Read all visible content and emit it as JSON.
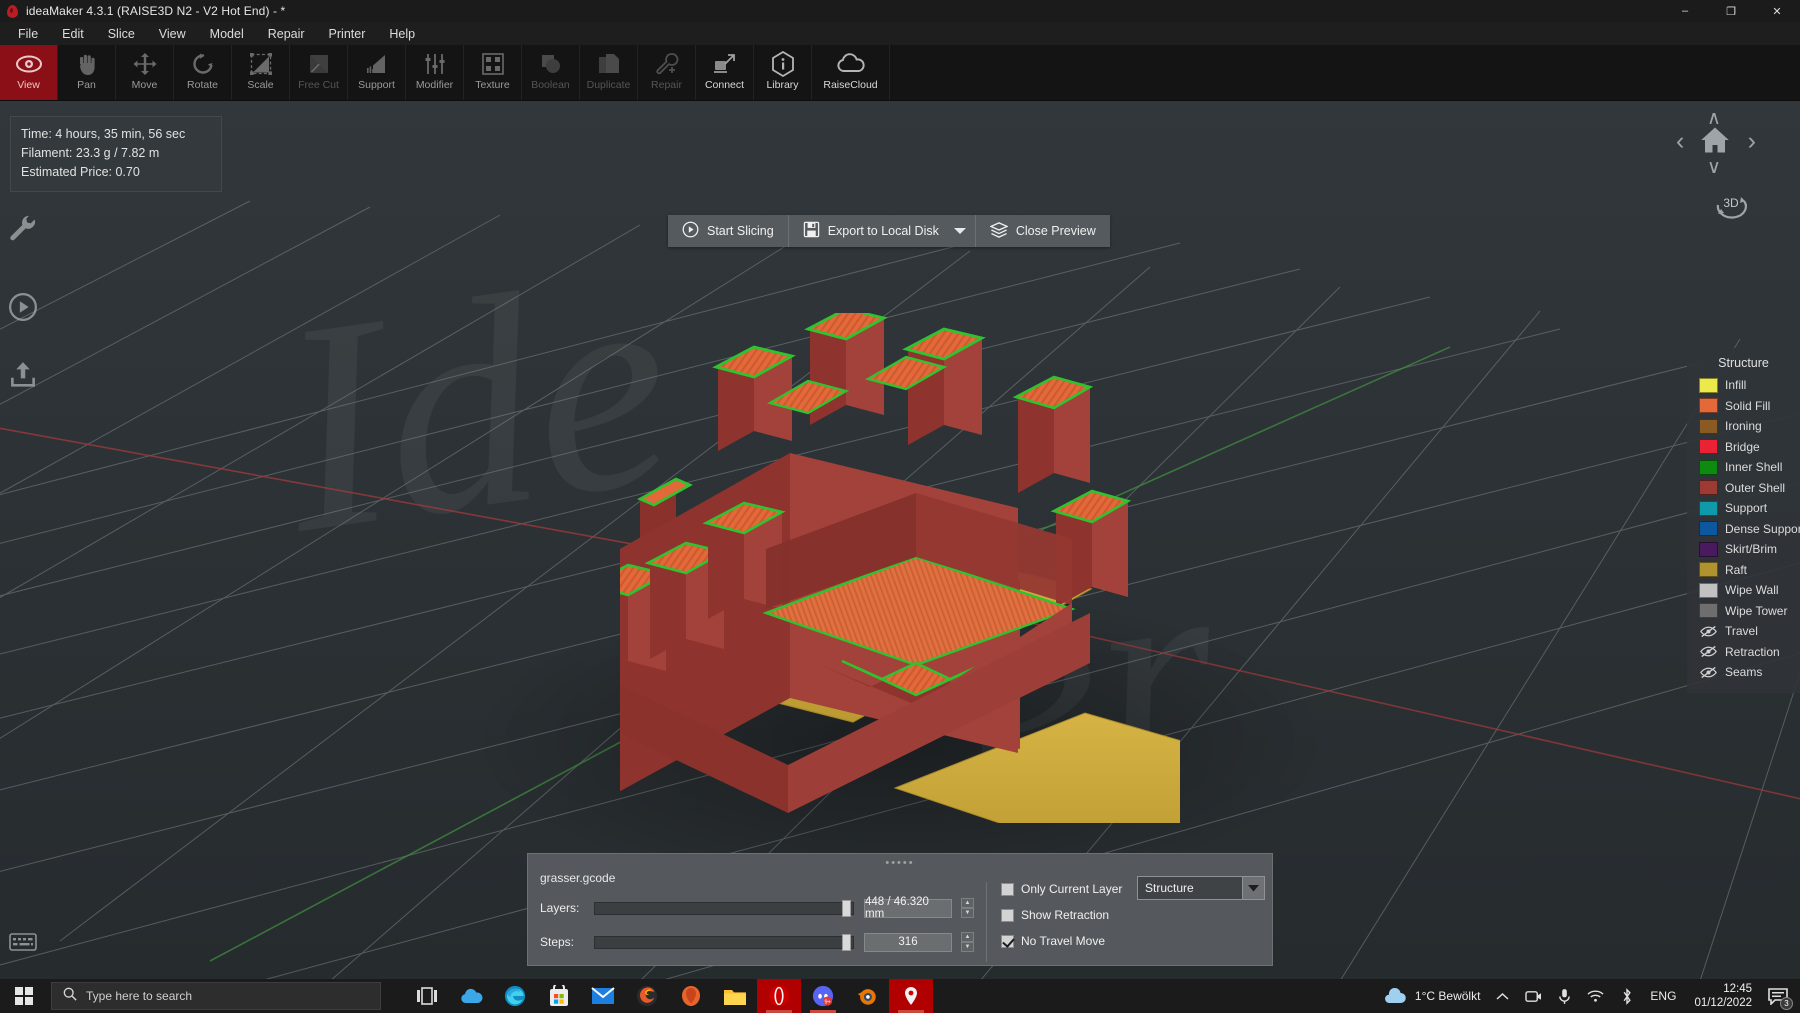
{
  "window": {
    "title": "ideaMaker 4.3.1 (RAISE3D N2 - V2 Hot End) - *",
    "minimize": "–",
    "maximize": "❐",
    "close": "✕"
  },
  "menu": {
    "items": [
      "File",
      "Edit",
      "Slice",
      "View",
      "Model",
      "Repair",
      "Printer",
      "Help"
    ]
  },
  "toolbar": {
    "items": [
      {
        "label": "View",
        "icon": "eye-icon",
        "state": "active"
      },
      {
        "label": "Pan",
        "icon": "hand-icon",
        "state": "normal"
      },
      {
        "label": "Move",
        "icon": "move-arrows-icon",
        "state": "normal"
      },
      {
        "label": "Rotate",
        "icon": "rotate-icon",
        "state": "normal"
      },
      {
        "label": "Scale",
        "icon": "scale-icon",
        "state": "normal"
      },
      {
        "label": "Free Cut",
        "icon": "free-cut-icon",
        "state": "disabled"
      },
      {
        "label": "Support",
        "icon": "support-icon",
        "state": "normal"
      },
      {
        "label": "Modifier",
        "icon": "sliders-icon",
        "state": "normal"
      },
      {
        "label": "Texture",
        "icon": "texture-grid-icon",
        "state": "normal"
      },
      {
        "label": "Boolean",
        "icon": "boolean-icon",
        "state": "disabled"
      },
      {
        "label": "Duplicate",
        "icon": "duplicate-icon",
        "state": "disabled"
      },
      {
        "label": "Repair",
        "icon": "wrench-plus-icon",
        "state": "disabled"
      },
      {
        "label": "Connect",
        "icon": "connect-icon",
        "state": "normal"
      },
      {
        "label": "Library",
        "icon": "info-hex-icon",
        "state": "normal"
      },
      {
        "label": "RaiseCloud",
        "icon": "cloud-icon",
        "state": "normal"
      }
    ]
  },
  "info": {
    "time": "Time: 4 hours, 35 min, 56 sec",
    "filament": "Filament: 23.3 g / 7.82 m",
    "price": "Estimated Price: 0.70"
  },
  "actions": {
    "start_slicing": "Start Slicing",
    "export_to_local_disk": "Export to Local Disk",
    "close_preview": "Close Preview"
  },
  "navigation": {
    "up": "∧",
    "down": "∨",
    "left": "‹",
    "right": "›",
    "home": "home-icon",
    "cube": "3D"
  },
  "legend": {
    "title": "Structure",
    "items": [
      {
        "label": "Infill",
        "color": "#ece94a",
        "type": "swatch"
      },
      {
        "label": "Solid Fill",
        "color": "#e3693a",
        "type": "swatch"
      },
      {
        "label": "Ironing",
        "color": "#8a5a22",
        "type": "swatch"
      },
      {
        "label": "Bridge",
        "color": "#ea2233",
        "type": "swatch"
      },
      {
        "label": "Inner Shell",
        "color": "#0e8a10",
        "type": "swatch"
      },
      {
        "label": "Outer Shell",
        "color": "#9c3a34",
        "type": "swatch"
      },
      {
        "label": "Support",
        "color": "#0f9aac",
        "type": "swatch"
      },
      {
        "label": "Dense Support",
        "color": "#0b57a0",
        "type": "swatch"
      },
      {
        "label": "Skirt/Brim",
        "color": "#4a1a5e",
        "type": "swatch"
      },
      {
        "label": "Raft",
        "color": "#b0932f",
        "type": "swatch"
      },
      {
        "label": "Wipe Wall",
        "color": "#c2c2c2",
        "type": "swatch"
      },
      {
        "label": "Wipe Tower",
        "color": "#6e6e6e",
        "type": "swatch"
      },
      {
        "label": "Travel",
        "color": "",
        "type": "eye-off"
      },
      {
        "label": "Retraction",
        "color": "",
        "type": "eye-off"
      },
      {
        "label": "Seams",
        "color": "",
        "type": "eye-off"
      }
    ]
  },
  "preview_panel": {
    "filename": "grasser.gcode",
    "layers_label": "Layers:",
    "layers_value": "448 / 46.320 mm",
    "steps_label": "Steps:",
    "steps_value": "316",
    "only_current_layer": {
      "label": "Only Current Layer",
      "checked": false
    },
    "show_retraction": {
      "label": "Show Retraction",
      "checked": false
    },
    "no_travel_move": {
      "label": "No Travel Move",
      "checked": true
    },
    "mode_select": {
      "value": "Structure"
    }
  },
  "taskbar": {
    "search_placeholder": "Type here to search",
    "weather": "1°C  Bewölkt",
    "language": "ENG",
    "time": "12:45",
    "date": "01/12/2022",
    "notification_count": "3",
    "apps": [
      {
        "name": "task-view-icon"
      },
      {
        "name": "onedrive-icon"
      },
      {
        "name": "edge-icon"
      },
      {
        "name": "microsoft-store-icon"
      },
      {
        "name": "mail-icon"
      },
      {
        "name": "firefox-icon"
      },
      {
        "name": "thunderbird-icon"
      },
      {
        "name": "file-explorer-icon"
      },
      {
        "name": "opera-icon"
      },
      {
        "name": "discord-icon"
      },
      {
        "name": "blender-icon"
      },
      {
        "name": "ideamaker-icon"
      }
    ]
  },
  "model": {
    "colors": {
      "outer_shell": "#9c3a34",
      "solid_fill": "#e3693a",
      "inner_shell": "#1fc21f",
      "raft": "#c9a83c",
      "bed": "#2b3034"
    }
  }
}
